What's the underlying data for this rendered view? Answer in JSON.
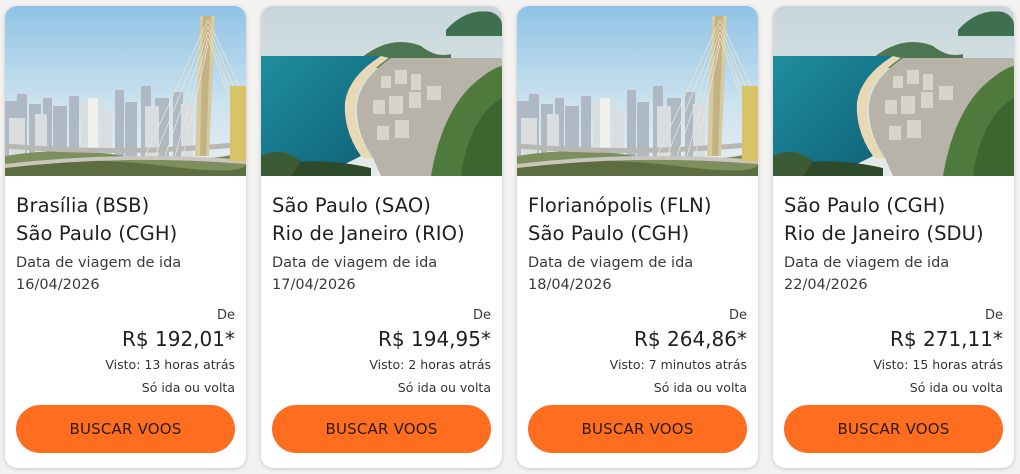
{
  "cards": [
    {
      "photo": "bridge-skyline-image",
      "origin": "Brasília (BSB)",
      "destination": "São Paulo (CGH)",
      "date_label": "Data de viagem de ida",
      "date": "16/04/2026",
      "price_prefix": "De",
      "price": "R$ 192,01*",
      "seen": "Visto: 13 horas atrás",
      "trip_type": "Só ida ou volta",
      "button": "BUSCAR VOOS"
    },
    {
      "photo": "beach-coast-image",
      "origin": "São Paulo (SAO)",
      "destination": "Rio de Janeiro (RIO)",
      "date_label": "Data de viagem de ida",
      "date": "17/04/2026",
      "price_prefix": "De",
      "price": "R$ 194,95*",
      "seen": "Visto: 2 horas atrás",
      "trip_type": "Só ida ou volta",
      "button": "BUSCAR VOOS"
    },
    {
      "photo": "bridge-skyline-image",
      "origin": "Florianópolis (FLN)",
      "destination": "São Paulo (CGH)",
      "date_label": "Data de viagem de ida",
      "date": "18/04/2026",
      "price_prefix": "De",
      "price": "R$ 264,86*",
      "seen": "Visto: 7 minutos atrás",
      "trip_type": "Só ida ou volta",
      "button": "BUSCAR VOOS"
    },
    {
      "photo": "beach-coast-image",
      "origin": "São Paulo (CGH)",
      "destination": "Rio de Janeiro (SDU)",
      "date_label": "Data de viagem de ida",
      "date": "22/04/2026",
      "price_prefix": "De",
      "price": "R$ 271,11*",
      "seen": "Visto: 15 horas atrás",
      "trip_type": "Só ida ou volta",
      "button": "BUSCAR VOOS"
    }
  ],
  "colors": {
    "button": "#ff6d1f",
    "card": "#ffffff",
    "page": "#f3f2f1"
  }
}
